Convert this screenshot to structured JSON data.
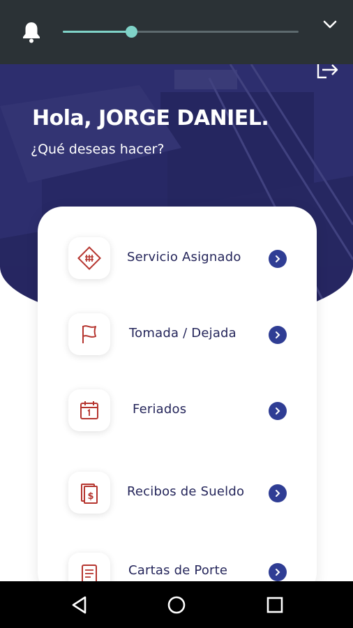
{
  "status_shade": {
    "icons": {
      "bell": "bell-icon",
      "expand": "chevron-down-icon"
    },
    "brightness_slider": {
      "level": 0.29
    }
  },
  "header": {
    "greeting": "Hola, JORGE DANIEL.",
    "subtitle": "¿Qué deseas hacer?",
    "logout_icon": "logout-icon"
  },
  "menu": {
    "items": [
      {
        "label": "Servicio Asignado",
        "icon": "railroad-crossing-icon"
      },
      {
        "label": "Tomada / Dejada",
        "icon": "flag-icon"
      },
      {
        "label": "Feriados",
        "icon": "calendar-icon"
      },
      {
        "label": "Recibos de Sueldo",
        "icon": "receipt-money-icon"
      },
      {
        "label": "Cartas de Porte",
        "icon": "document-icon"
      }
    ]
  },
  "colors": {
    "hero_bg": "#2d2e6e",
    "accent": "#2f3d94",
    "icon_red": "#b5342e",
    "label": "#24255a",
    "slider": "#7fd3c8"
  },
  "navbar": {
    "icons": [
      "back-icon",
      "home-icon",
      "recents-icon"
    ]
  }
}
